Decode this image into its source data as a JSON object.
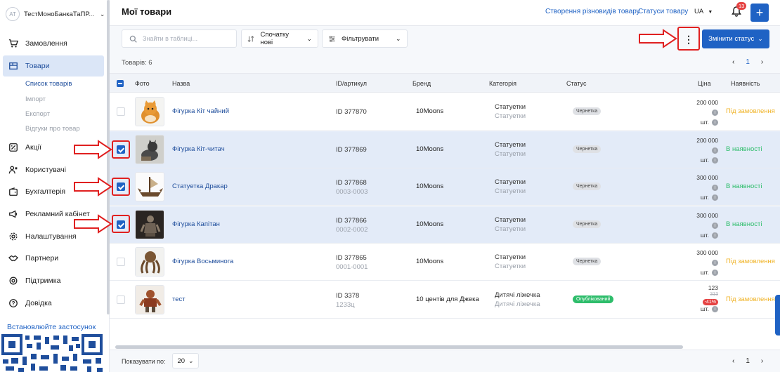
{
  "sidebar": {
    "account": {
      "avatar": "АТ",
      "name": "ТестМоноБанкаТаПР..."
    },
    "items": [
      {
        "label": "Замовлення",
        "icon": "cart-icon"
      },
      {
        "label": "Товари",
        "icon": "box-icon"
      },
      {
        "label": "Акції",
        "icon": "discount-icon"
      },
      {
        "label": "Користувачі",
        "icon": "users-icon"
      },
      {
        "label": "Бухгалтерія",
        "icon": "wallet-icon"
      },
      {
        "label": "Рекламний кабінет",
        "icon": "megaphone-icon"
      },
      {
        "label": "Налаштування",
        "icon": "gear-icon"
      },
      {
        "label": "Партнери",
        "icon": "handshake-icon"
      },
      {
        "label": "Підтримка",
        "icon": "support-icon"
      },
      {
        "label": "Довідка",
        "icon": "help-icon"
      }
    ],
    "subitems": [
      "Список товарів",
      "Імпорт",
      "Експорт",
      "Відгуки про товар"
    ],
    "install": "Встановлюйте застосунок"
  },
  "header": {
    "title": "Мої товари",
    "link_variants": "Створення різновидів товару",
    "link_statuses": "Статуси товару",
    "lang": "UA",
    "notifications": "13",
    "add_label": "+"
  },
  "toolbar": {
    "search_placeholder": "Знайти в таблиці...",
    "sort_label": "Спочатку нові",
    "filter_label": "Фільтрувати",
    "kebab_label": "⋮",
    "change_status_label": "Змінити статус"
  },
  "list": {
    "count": "Товарів: 6",
    "page": "1",
    "prev": "‹",
    "next": "›"
  },
  "table": {
    "headers": [
      "Фото",
      "Назва",
      "ID/артикул",
      "Бренд",
      "Категорія",
      "Статус",
      "Ціна",
      "Наявність"
    ],
    "rows": [
      {
        "name": "Фігурка Кіт чайний",
        "id": "ID 377870",
        "sku": "",
        "brand": "10Moons",
        "cat": "Статуетки",
        "cat_sub": "Статуетки",
        "status": "Чернетка",
        "price": "200 000",
        "unit": "шт.",
        "old": "",
        "disc": "",
        "avail": "Під замовлення",
        "selected": false
      },
      {
        "name": "Фігурка Кіт-читач",
        "id": "ID 377869",
        "sku": "",
        "brand": "10Moons",
        "cat": "Статуетки",
        "cat_sub": "Статуетки",
        "status": "Чернетка",
        "price": "200 000",
        "unit": "шт.",
        "old": "",
        "disc": "",
        "avail": "В наявності",
        "selected": true
      },
      {
        "name": "Статуетка Дракар",
        "id": "ID 377868",
        "sku": "0003-0003",
        "brand": "10Moons",
        "cat": "Статуетки",
        "cat_sub": "Статуетки",
        "status": "Чернетка",
        "price": "300 000",
        "unit": "шт.",
        "old": "",
        "disc": "",
        "avail": "В наявності",
        "selected": true
      },
      {
        "name": "Фігурка Капітан",
        "id": "ID 377866",
        "sku": "0002-0002",
        "brand": "10Moons",
        "cat": "Статуетки",
        "cat_sub": "Статуетки",
        "status": "Чернетка",
        "price": "300 000",
        "unit": "шт.",
        "old": "",
        "disc": "",
        "avail": "В наявності",
        "selected": true
      },
      {
        "name": "Фігурка Восьминога",
        "id": "ID 377865",
        "sku": "0001-0001",
        "brand": "10Moons",
        "cat": "Статуетки",
        "cat_sub": "Статуетки",
        "status": "Чернетка",
        "price": "300 000",
        "unit": "шт.",
        "old": "",
        "disc": "",
        "avail": "Під замовлення",
        "selected": false
      },
      {
        "name": "тест",
        "id": "ID 3378",
        "sku": "1233ц",
        "brand": "10 центів для Джека",
        "cat": "Дитячі ліжечка",
        "cat_sub": "Дитячі ліжечка",
        "status": "Опублікований",
        "price": "123",
        "unit": "шт.",
        "old": "313",
        "disc": "-41%",
        "avail": "Під замовлення",
        "selected": false
      }
    ]
  },
  "footer": {
    "show_label": "Показувати по:",
    "per_page": "20",
    "page": "1"
  },
  "colors": {
    "accent": "#1f62c4",
    "annotation": "#e02020",
    "available": "#2ebd6b",
    "on_order": "#f0b429"
  }
}
